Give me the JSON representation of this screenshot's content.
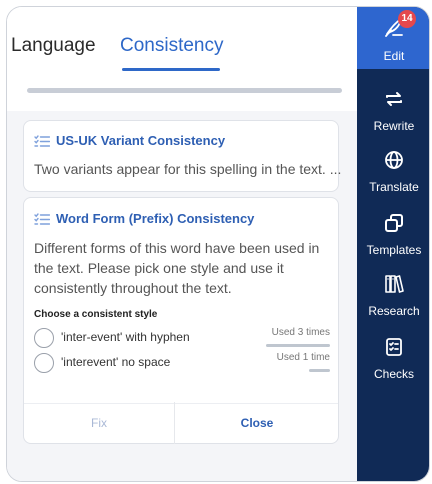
{
  "colors": {
    "accent": "#2e68c8",
    "sidebar_bg": "#102a56",
    "sidebar_active": "#2e66cf",
    "badge": "#e5484d"
  },
  "tabs": [
    {
      "label": "Language",
      "active": false
    },
    {
      "label": "Consistency",
      "active": true
    }
  ],
  "cards": [
    {
      "icon": "list-check-icon",
      "title": "US-UK Variant Consistency",
      "text": "Two variants appear for this spelling in the text. ..."
    },
    {
      "icon": "list-check-icon",
      "title": "Word Form (Prefix) Consistency",
      "text": "Different forms of this word have been used in the text. Please pick one style and use it consistently throughout the text.",
      "style_prompt": "Choose a consistent style",
      "options": [
        {
          "label": "'inter-event' with hyphen",
          "usage": "Used 3 times",
          "usage_fraction": 1.0
        },
        {
          "label": "'interevent' no space",
          "usage": "Used 1 time",
          "usage_fraction": 0.33
        }
      ],
      "fix_label": "Fix",
      "close_label": "Close"
    }
  ],
  "sidebar": {
    "items": [
      {
        "label": "Edit",
        "icon": "quill-pen-icon",
        "badge": "14",
        "active": true
      },
      {
        "label": "Rewrite",
        "icon": "swap-arrows-icon"
      },
      {
        "label": "Translate",
        "icon": "globe-icon"
      },
      {
        "label": "Templates",
        "icon": "copy-icon"
      },
      {
        "label": "Research",
        "icon": "books-icon"
      },
      {
        "label": "Checks",
        "icon": "checklist-icon"
      }
    ]
  }
}
